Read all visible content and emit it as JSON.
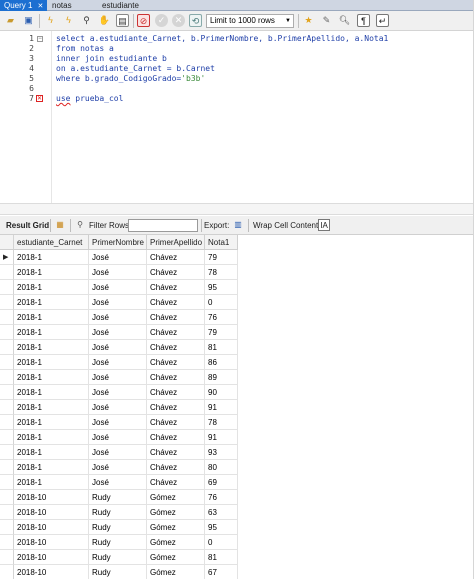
{
  "tabs": [
    {
      "label": "Query 1",
      "active": true,
      "closable": true
    },
    {
      "label": "notas",
      "active": false,
      "closable": false
    },
    {
      "label": "estudiante",
      "active": false,
      "closable": false
    }
  ],
  "toolbar": {
    "limit_label": "Limit to 1000 rows",
    "icons": [
      "open-file-icon",
      "save-icon",
      "execute-icon",
      "execute-current-icon",
      "explain-icon",
      "stop-icon",
      "find-icon",
      "toggle-output-icon",
      "stop-on-error-icon",
      "commit-icon",
      "rollback-icon",
      "autocommit-icon",
      "beautify-icon",
      "search-replace-icon",
      "invisible-chars-icon",
      "wrap-icon"
    ]
  },
  "editor": {
    "lines": [
      {
        "num": "1",
        "text": "select a.estudiante_Carnet, b.PrimerNombre, b.PrimerApellido, a.Nota1"
      },
      {
        "num": "2",
        "text": "from notas a"
      },
      {
        "num": "3",
        "text": "inner join estudiante b"
      },
      {
        "num": "4",
        "text": "on a.estudiante_Carnet = b.Carnet"
      },
      {
        "num": "5",
        "text_pre": "where b.grado_CodigoGrado=",
        "text_str": "'b3b'"
      },
      {
        "num": "6",
        "text": ""
      },
      {
        "num": "7",
        "text_err": "use",
        "text_post": " prueba_col"
      }
    ]
  },
  "result_toolbar": {
    "result_grid_label": "Result Grid",
    "filter_label": "Filter Rows:",
    "filter_value": "",
    "export_label": "Export:",
    "wrap_label": "Wrap Cell Content:"
  },
  "grid": {
    "columns": [
      "estudiante_Carnet",
      "PrimerNombre",
      "PrimerApellido",
      "Nota1"
    ],
    "rows": [
      [
        "2018-1",
        "José",
        "Chávez",
        "79"
      ],
      [
        "2018-1",
        "José",
        "Chávez",
        "78"
      ],
      [
        "2018-1",
        "José",
        "Chávez",
        "95"
      ],
      [
        "2018-1",
        "José",
        "Chávez",
        "0"
      ],
      [
        "2018-1",
        "José",
        "Chávez",
        "76"
      ],
      [
        "2018-1",
        "José",
        "Chávez",
        "79"
      ],
      [
        "2018-1",
        "José",
        "Chávez",
        "81"
      ],
      [
        "2018-1",
        "José",
        "Chávez",
        "86"
      ],
      [
        "2018-1",
        "José",
        "Chávez",
        "89"
      ],
      [
        "2018-1",
        "José",
        "Chávez",
        "90"
      ],
      [
        "2018-1",
        "José",
        "Chávez",
        "91"
      ],
      [
        "2018-1",
        "José",
        "Chávez",
        "78"
      ],
      [
        "2018-1",
        "José",
        "Chávez",
        "91"
      ],
      [
        "2018-1",
        "José",
        "Chávez",
        "93"
      ],
      [
        "2018-1",
        "José",
        "Chávez",
        "80"
      ],
      [
        "2018-1",
        "José",
        "Chávez",
        "69"
      ],
      [
        "2018-10",
        "Rudy",
        "Gómez",
        "76"
      ],
      [
        "2018-10",
        "Rudy",
        "Gómez",
        "63"
      ],
      [
        "2018-10",
        "Rudy",
        "Gómez",
        "95"
      ],
      [
        "2018-10",
        "Rudy",
        "Gómez",
        "0"
      ],
      [
        "2018-10",
        "Rudy",
        "Gómez",
        "81"
      ],
      [
        "2018-10",
        "Rudy",
        "Gómez",
        "67"
      ]
    ]
  }
}
